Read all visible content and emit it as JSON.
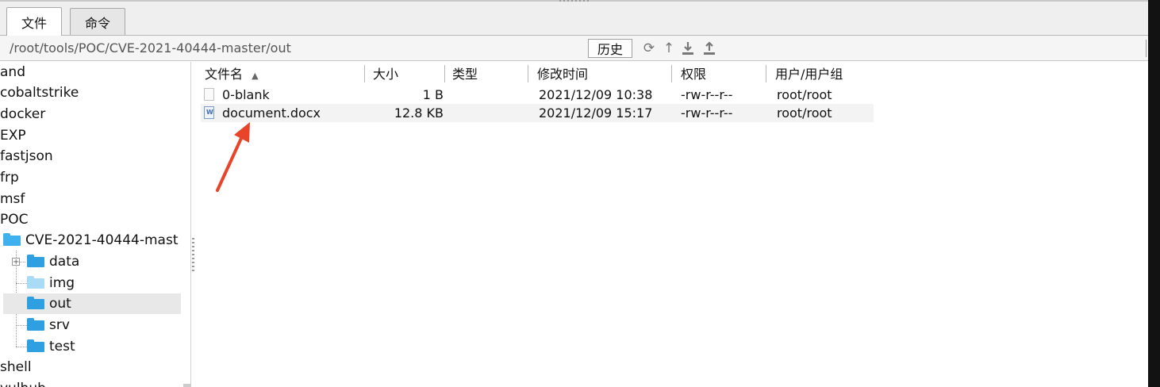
{
  "tabs": [
    {
      "label": "文件",
      "active": true
    },
    {
      "label": "命令",
      "active": false
    }
  ],
  "path": {
    "value": "/root/tools/POC/CVE-2021-40444-master/out",
    "history_label": "历史"
  },
  "toolbar_icons": [
    "refresh-icon",
    "up-directory-icon",
    "download-icon",
    "upload-icon"
  ],
  "tree": {
    "items": [
      {
        "label": "and"
      },
      {
        "label": "cobaltstrike"
      },
      {
        "label": "docker"
      },
      {
        "label": "EXP"
      },
      {
        "label": "fastjson"
      },
      {
        "label": "frp"
      },
      {
        "label": "msf"
      },
      {
        "label": "POC"
      },
      {
        "label": "CVE-2021-40444-mast"
      },
      {
        "label": "data"
      },
      {
        "label": "img"
      },
      {
        "label": "out",
        "selected": true
      },
      {
        "label": "srv"
      },
      {
        "label": "test"
      },
      {
        "label": "shell"
      },
      {
        "label": "vulhub"
      }
    ]
  },
  "table": {
    "columns": [
      "文件名",
      "大小",
      "类型",
      "修改时间",
      "权限",
      "用户/用户组"
    ],
    "sort_indicator": "▲",
    "rows": [
      {
        "name": "0-blank",
        "size": "1 B",
        "type": "",
        "modified": "2021/12/09 10:38",
        "perm": "-rw-r--r--",
        "owner": "root/root"
      },
      {
        "name": "document.docx",
        "size": "12.8 KB",
        "type": "",
        "modified": "2021/12/09 15:17",
        "perm": "-rw-r--r--",
        "owner": "root/root"
      }
    ]
  },
  "colors": {
    "annotation_arrow": "#e8442a",
    "folder_blue": "#2e9fe0"
  }
}
